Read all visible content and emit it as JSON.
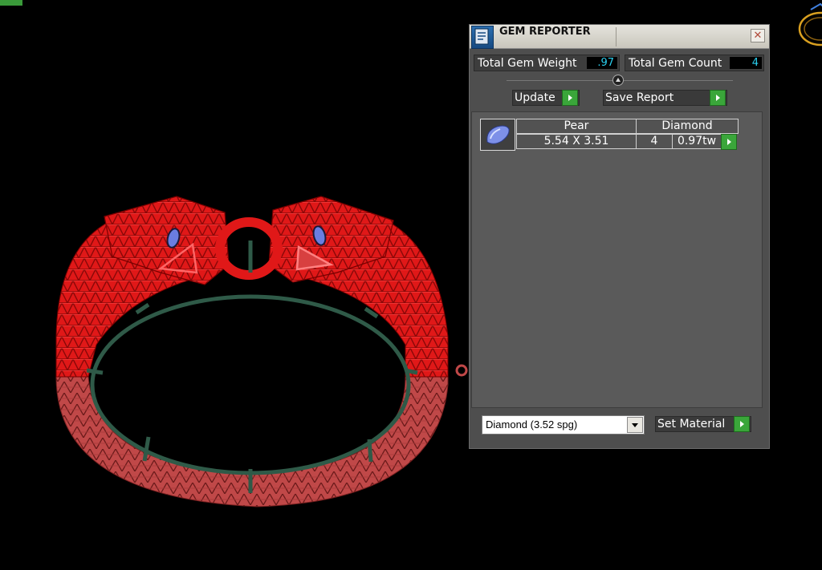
{
  "colors": {
    "metal_red": "#e01818",
    "metal_pink": "#c04848",
    "wire_green": "#2f5a48",
    "gem_blue": "#6a7de0",
    "accent_green": "#3aa63a",
    "value_cyan": "#2ad0f0",
    "ring_gold": "#d9a020"
  },
  "panel": {
    "title": "GEM REPORTER",
    "title_icon": "report-icon",
    "close_icon": "close-icon",
    "close_glyph": "✕",
    "total_weight_label": "Total Gem Weight",
    "total_weight_value": ".97",
    "total_count_label": "Total Gem Count",
    "total_count_value": "4",
    "update_label": "Update",
    "save_report_label": "Save Report",
    "gems": [
      {
        "shape": "Pear",
        "material": "Diamond",
        "size": "5.54 X 3.51",
        "count": "4",
        "weight": "0.97tw",
        "icon": "pear-gem-icon"
      }
    ],
    "material_select": {
      "value": "Diamond     (3.52 spg)"
    },
    "set_material_label": "Set Material"
  },
  "viewport": {
    "model_icon": "bracelet-model",
    "corner_icon": "ring-icon"
  }
}
